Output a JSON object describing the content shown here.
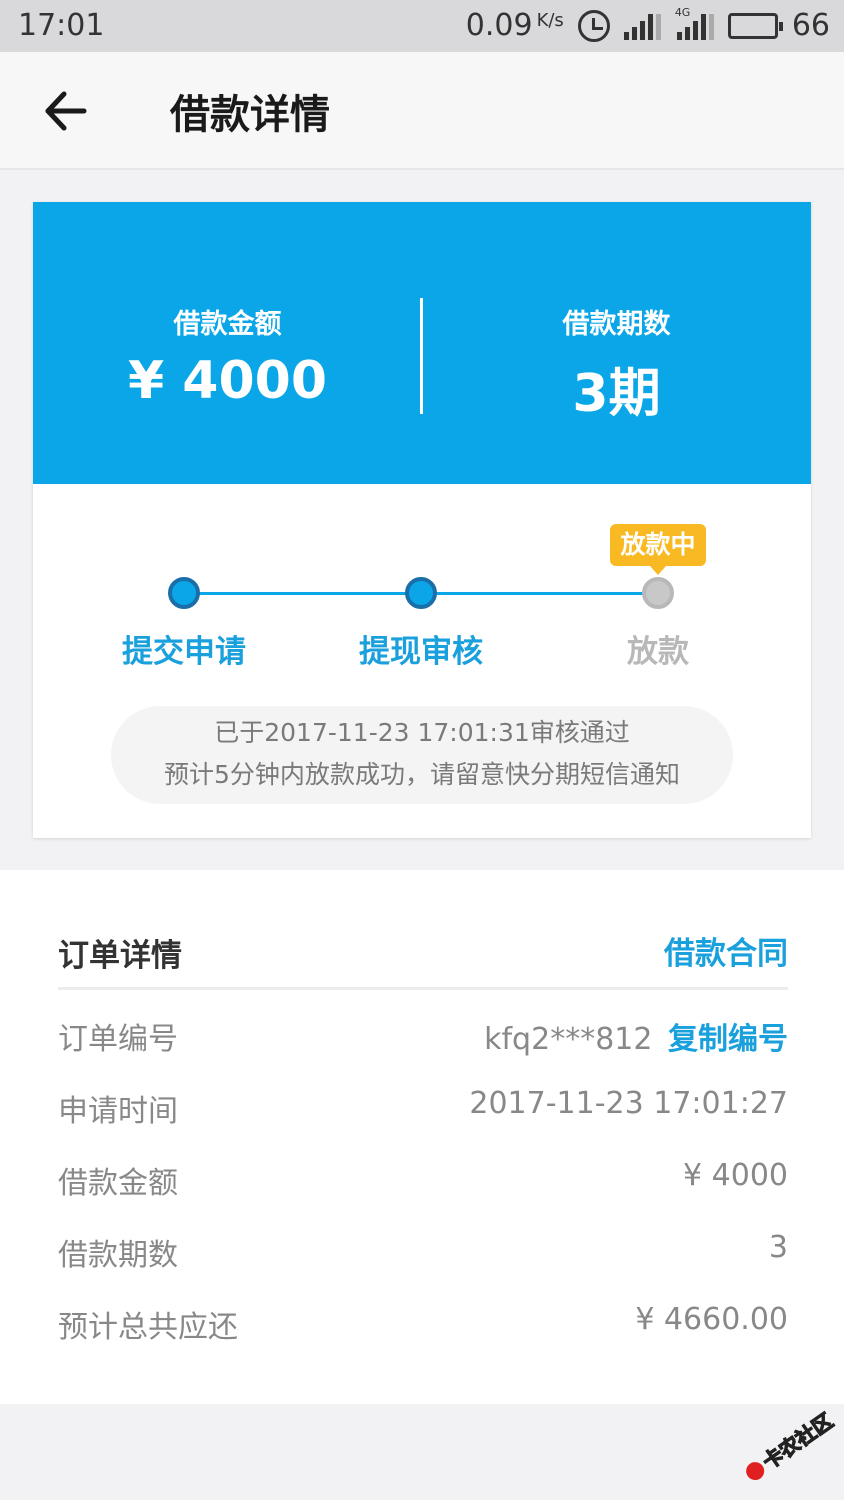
{
  "status_bar": {
    "time": "17:01",
    "net_speed": "0.09",
    "net_unit": "K/s",
    "network_tag": "4G",
    "battery": "66"
  },
  "header": {
    "title": "借款详情"
  },
  "summary": {
    "amount_label": "借款金额",
    "amount_value": "¥ 4000",
    "term_label": "借款期数",
    "term_value": "3期"
  },
  "progress": {
    "steps": [
      {
        "label": "提交申请",
        "done": true
      },
      {
        "label": "提现审核",
        "done": true
      },
      {
        "label": "放款",
        "done": false
      }
    ],
    "badge": "放款中",
    "notice_line1": "已于2017-11-23 17:01:31审核通过",
    "notice_line2": "预计5分钟内放款成功，请留意快分期短信通知"
  },
  "order": {
    "title": "订单详情",
    "contract_link": "借款合同",
    "copy_label": "复制编号",
    "rows": [
      {
        "label": "订单编号",
        "value": "kfq2***812"
      },
      {
        "label": "申请时间",
        "value": "2017-11-23 17:01:27"
      },
      {
        "label": "借款金额",
        "value": "¥ 4000"
      },
      {
        "label": "借款期数",
        "value": "3"
      },
      {
        "label": "预计总共应还",
        "value": "¥ 4660.00"
      }
    ]
  },
  "watermark": {
    "text": "卡农社区"
  },
  "colors": {
    "accent": "#0aa6e8",
    "badge": "#f9b923",
    "link": "#1aa0dc"
  }
}
